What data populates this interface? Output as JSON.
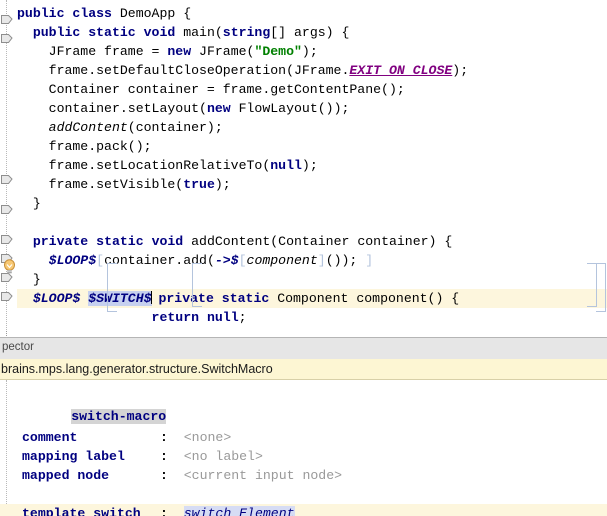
{
  "editor": {
    "lines": [
      {
        "id": "l1",
        "indent": 0,
        "segments": [
          {
            "t": "public",
            "c": "kw"
          },
          {
            "t": " ",
            "c": "plain"
          },
          {
            "t": "class",
            "c": "kw"
          },
          {
            "t": " DemoApp {",
            "c": "plain"
          }
        ]
      },
      {
        "id": "l2",
        "indent": 0,
        "segments": [
          {
            "t": "  ",
            "c": "plain"
          },
          {
            "t": "public",
            "c": "kw"
          },
          {
            "t": " ",
            "c": "plain"
          },
          {
            "t": "static",
            "c": "kw"
          },
          {
            "t": " ",
            "c": "plain"
          },
          {
            "t": "void",
            "c": "kw"
          },
          {
            "t": " main(",
            "c": "plain"
          },
          {
            "t": "string",
            "c": "kw"
          },
          {
            "t": "[] args) {",
            "c": "plain"
          }
        ]
      },
      {
        "id": "l3",
        "indent": 0,
        "segments": [
          {
            "t": "    JFrame frame = ",
            "c": "plain"
          },
          {
            "t": "new",
            "c": "kw"
          },
          {
            "t": " JFrame(",
            "c": "plain"
          },
          {
            "t": "\"Demo\"",
            "c": "str"
          },
          {
            "t": ");",
            "c": "plain"
          }
        ]
      },
      {
        "id": "l4",
        "indent": 0,
        "segments": [
          {
            "t": "    frame.setDefaultCloseOperation(JFrame.",
            "c": "plain"
          },
          {
            "t": "EXIT_ON_CLOSE",
            "c": "stat"
          },
          {
            "t": ");",
            "c": "plain"
          }
        ]
      },
      {
        "id": "l5",
        "indent": 0,
        "segments": [
          {
            "t": "    Container container = frame.getContentPane();",
            "c": "plain"
          }
        ]
      },
      {
        "id": "l6",
        "indent": 0,
        "segments": [
          {
            "t": "    container.setLayout(",
            "c": "plain"
          },
          {
            "t": "new",
            "c": "kw"
          },
          {
            "t": " FlowLayout());",
            "c": "plain"
          }
        ]
      },
      {
        "id": "l7",
        "indent": 0,
        "segments": [
          {
            "t": "    ",
            "c": "plain"
          },
          {
            "t": "addContent",
            "c": "mth"
          },
          {
            "t": "(container);",
            "c": "plain"
          }
        ]
      },
      {
        "id": "l8",
        "indent": 0,
        "segments": [
          {
            "t": "    frame.pack();",
            "c": "plain"
          }
        ]
      },
      {
        "id": "l9",
        "indent": 0,
        "segments": [
          {
            "t": "    frame.setLocationRelativeTo(",
            "c": "plain"
          },
          {
            "t": "null",
            "c": "kw"
          },
          {
            "t": ");",
            "c": "plain"
          }
        ]
      },
      {
        "id": "l10",
        "indent": 0,
        "segments": [
          {
            "t": "    frame.setVisible(",
            "c": "plain"
          },
          {
            "t": "true",
            "c": "kw"
          },
          {
            "t": ");",
            "c": "plain"
          }
        ]
      },
      {
        "id": "l11",
        "indent": 0,
        "segments": [
          {
            "t": "  }",
            "c": "plain"
          }
        ]
      },
      {
        "id": "l12",
        "indent": 0,
        "segments": [
          {
            "t": "",
            "c": "plain"
          }
        ]
      },
      {
        "id": "l13",
        "indent": 0,
        "segments": [
          {
            "t": "  ",
            "c": "plain"
          },
          {
            "t": "private",
            "c": "kw"
          },
          {
            "t": " ",
            "c": "plain"
          },
          {
            "t": "static",
            "c": "kw"
          },
          {
            "t": " ",
            "c": "plain"
          },
          {
            "t": "void",
            "c": "kw"
          },
          {
            "t": " addContent(Container container) {",
            "c": "plain"
          }
        ]
      },
      {
        "id": "l14",
        "indent": 0,
        "segments": [
          {
            "t": "    ",
            "c": "plain"
          },
          {
            "t": "$LOOP$",
            "c": "macro"
          },
          {
            "t": "[",
            "c": "brk"
          },
          {
            "t": "container.add(",
            "c": "plain"
          },
          {
            "t": "->$",
            "c": "arrow"
          },
          {
            "t": "[",
            "c": "brk"
          },
          {
            "t": "component",
            "c": "mth"
          },
          {
            "t": "]",
            "c": "brk"
          },
          {
            "t": "());",
            "c": "plain"
          },
          {
            "t": " ]",
            "c": "brk"
          }
        ]
      },
      {
        "id": "l15",
        "indent": 0,
        "segments": [
          {
            "t": "  }",
            "c": "plain"
          }
        ]
      },
      {
        "id": "l16",
        "highlight": true,
        "indent": 0,
        "segments": [
          {
            "t": "  ",
            "c": "plain"
          },
          {
            "t": "$LOOP$",
            "c": "macro"
          },
          {
            "t": " ",
            "c": "plain"
          },
          {
            "t": "$SWITCH$",
            "c": "macro sel",
            "caret": true
          },
          {
            "t": " ",
            "c": "plain"
          },
          {
            "t": "private",
            "c": "kw"
          },
          {
            "t": " ",
            "c": "plain"
          },
          {
            "t": "static",
            "c": "kw"
          },
          {
            "t": " Component component() {",
            "c": "plain"
          }
        ]
      },
      {
        "id": "l17",
        "indent": 0,
        "segments": [
          {
            "t": "                 ",
            "c": "plain"
          },
          {
            "t": "return",
            "c": "kw"
          },
          {
            "t": " ",
            "c": "plain"
          },
          {
            "t": "null",
            "c": "kw"
          },
          {
            "t": ";",
            "c": "plain"
          }
        ]
      },
      {
        "id": "l18",
        "indent": 0,
        "segments": [
          {
            "t": "               }",
            "c": "plain"
          }
        ]
      },
      {
        "id": "l19",
        "indent": 0,
        "segments": [
          {
            "t": " }",
            "c": "plain"
          }
        ]
      }
    ],
    "fold_markers": 8,
    "bulb_icon": "lightbulb-icon"
  },
  "splitter": {
    "name": "horizontal-splitter"
  },
  "tabbar": {
    "tab_label": "pector"
  },
  "breadcrumb": {
    "path": "brains.mps.lang.generator.structure.SwitchMacro"
  },
  "inspector": {
    "node_name": "switch-macro",
    "properties": [
      {
        "label": "comment",
        "colon": ":",
        "value": "<none>",
        "value_kind": "placeholder"
      },
      {
        "label": "mapping label",
        "colon": ":",
        "value": "<no label>",
        "value_kind": "placeholder"
      },
      {
        "label": "mapped node",
        "colon": ":",
        "value": "<current input node>",
        "value_kind": "placeholder"
      },
      {
        "label": "template switch",
        "colon": ":",
        "value": "switch_Element",
        "value_kind": "selected",
        "highlight": true
      }
    ]
  },
  "colors": {
    "keyword": "#000080",
    "string": "#008000",
    "static_field": "#800080",
    "macro": "#000080",
    "bracket": "#b4c4dd",
    "line_highlight": "#fdf6dd",
    "selection": "#c6d0ef",
    "breadcrumb_bg": "#fdf6d3",
    "tabbar_bg": "#e6e6e6"
  }
}
